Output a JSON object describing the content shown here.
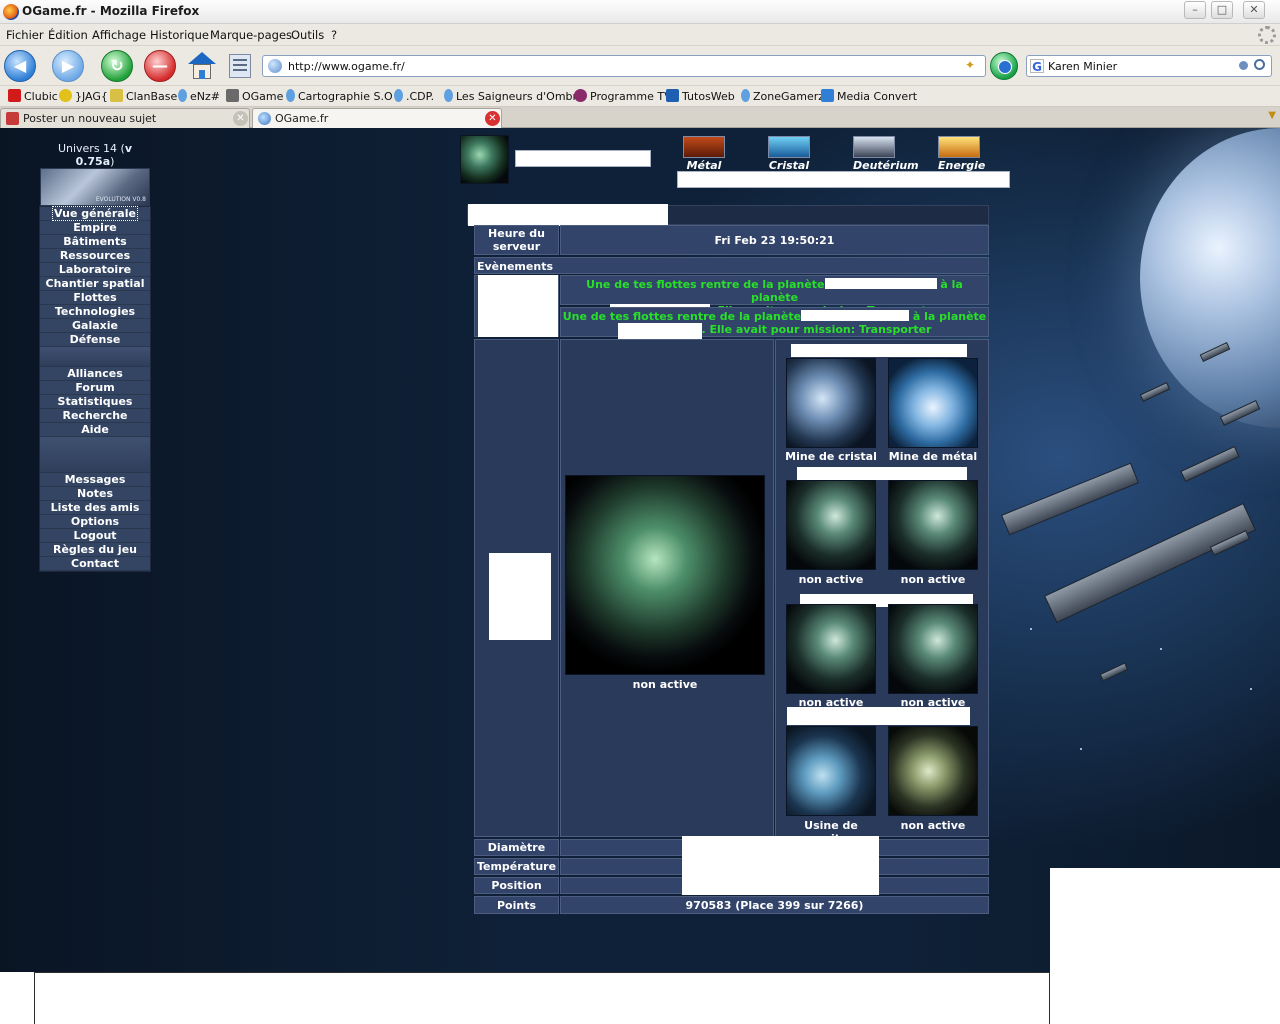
{
  "window": {
    "title": "OGame.fr - Mozilla Firefox"
  },
  "menubar": [
    "Fichier",
    "Édition",
    "Affichage",
    "Historique",
    "Marque-pages",
    "Outils",
    "?"
  ],
  "navbar": {
    "url": "http://www.ogame.fr/",
    "search_value": "Karen Minier",
    "search_engine_icon": "google-icon"
  },
  "bookmarks": [
    {
      "label": "Clubic",
      "color": "#d11b1b"
    },
    {
      "label": "}JAG{",
      "color": "#e2c21a"
    },
    {
      "label": "ClanBase",
      "color": "#d7c043"
    },
    {
      "label": "eNz#",
      "color": "#5ea0e0"
    },
    {
      "label": "OGame",
      "color": "#6a6a6a"
    },
    {
      "label": "Cartographie S.O",
      "color": "#5ea0e0"
    },
    {
      "label": ".CDP.",
      "color": "#5ea0e0"
    },
    {
      "label": "Les Saigneurs d'Ombre",
      "color": "#5ea0e0"
    },
    {
      "label": "Programme TV",
      "color": "#8b2a6b"
    },
    {
      "label": "TutosWeb",
      "color": "#1f5fb2"
    },
    {
      "label": "ZoneGamerz",
      "color": "#5ea0e0"
    },
    {
      "label": "Media Convert",
      "color": "#2f7fd6"
    }
  ],
  "tabs": [
    {
      "label": "Poster un nouveau sujet"
    },
    {
      "label": "OGame.fr"
    }
  ],
  "game": {
    "univers_prefix": "Univers 14 (",
    "univers_version": "v 0.75a",
    "univers_suffix": ")",
    "logo_caption": "EVOLUTION V0.8",
    "menu_group1": [
      "Vue générale",
      "Empire",
      "Bâtiments",
      "Ressources",
      "Laboratoire",
      "Chantier spatial",
      "Flottes",
      "Technologies",
      "Galaxie",
      "Défense"
    ],
    "menu_group2": [
      "Alliances",
      "Forum",
      "Statistiques",
      "Recherche",
      "Aide"
    ],
    "menu_group3": [
      "Messages",
      "Notes",
      "Liste des amis",
      "Options",
      "Logout",
      "Règles du jeu",
      "Contact"
    ],
    "resources": [
      "Métal",
      "Cristal",
      "Deutérium",
      "Energie"
    ],
    "server_time_label": "Heure du serveur",
    "server_time": "Fri Feb 23 19:50:21",
    "events_label": "Evènements",
    "event1_a": "Une de tes flottes rentre de la planète",
    "event1_b": "à la planète",
    "event1_c": ". Elle avait pour mission: Transporter",
    "event2_a": "Une de tes flottes rentre de la planète",
    "event2_b": "à la planète",
    "event2_c": ". Elle avait pour mission: Transporter",
    "main_planet_caption": "non active",
    "moons": [
      "Mine de cristal",
      "Mine de métal",
      "non active",
      "non active",
      "non active",
      "non active",
      "Usine de nanites",
      "non active"
    ],
    "stats": {
      "diametre_label": "Diamètre",
      "temperature_label": "Température",
      "position_label": "Position",
      "points_label": "Points",
      "points_value": "970583 (Place 399 sur 7266)"
    }
  },
  "colors": {
    "event_text": "#29e029",
    "menu_bg": "#344563",
    "cell_bg": "#33446a"
  }
}
